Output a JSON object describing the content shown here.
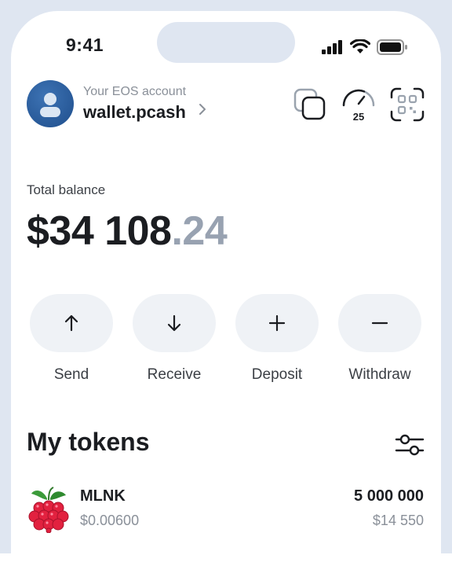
{
  "status_bar": {
    "time": "9:41"
  },
  "account": {
    "caption": "Your EOS account",
    "name": "wallet.pcash"
  },
  "header_icons": {
    "copy": "copy-icon",
    "gauge": "gauge-icon",
    "gauge_value": "25",
    "qr": "qr-scan-icon"
  },
  "balance": {
    "label": "Total balance",
    "whole": "$34 108",
    "cents": ".24"
  },
  "actions": [
    {
      "label": "Send",
      "icon": "arrow-up-icon"
    },
    {
      "label": "Receive",
      "icon": "arrow-down-icon"
    },
    {
      "label": "Deposit",
      "icon": "plus-icon"
    },
    {
      "label": "Withdraw",
      "icon": "minus-icon"
    }
  ],
  "tokens": {
    "title": "My tokens",
    "items": [
      {
        "symbol": "MLNK",
        "price": "$0.00600",
        "amount": "5 000 000",
        "value": "$14 550",
        "icon": "raspberry-icon"
      }
    ]
  },
  "colors": {
    "accent_bg": "#eff2f6",
    "muted_text": "#8a9099",
    "cents_gray": "#98a2b1",
    "frame": "#dfe6f1"
  }
}
